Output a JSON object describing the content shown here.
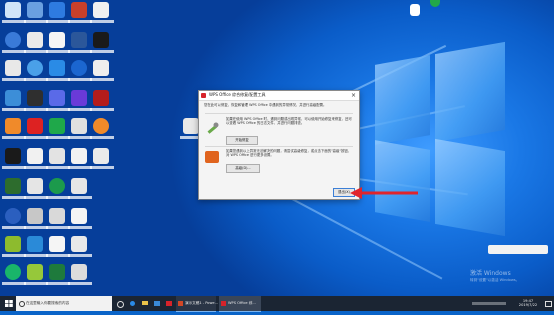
{
  "dialog": {
    "title": "WPS Office 综合修复/配置工具",
    "intro": "您在此可以修复、恢复和管理 WPS Office 中遇到的异常情况，并进行高级配置。",
    "section1_text": "如果在使用 WPS Office 时，遇到问题或出现异常，可以使用开始修复来修复，还可以查看 WPS Office 的日志文件，并进行问题排查。",
    "repair_button": "开始修复",
    "section2_text": "如果您遇到以上异常无法解决的问题，请尝试高级修复，或点击下面的\"高级\"按钮，对 WPS Office 进行更多设置。",
    "advanced_button": "高级(D)...",
    "exit_button": "退出(X)",
    "close_glyph": "×"
  },
  "taskbar": {
    "search_placeholder": "在这里输入你要搜索的内容",
    "task1_label": "演示文稿1 - Powe...",
    "task2_label": "WPS Office 综...",
    "time": "19:47",
    "date": "2019/7/22"
  },
  "watermark": {
    "line1": "激活 Windows",
    "line2": "转到\"设置\"以激活 Windows。"
  },
  "colors": {
    "desktop_blue": "#0a64c8",
    "arrow_red": "#e0242c",
    "taskbar": "#1b2533",
    "wps_red": "#d6232a"
  },
  "icons": [
    "start-windows-icon",
    "search-icon",
    "taskview-icon",
    "edge-icon",
    "explorer-icon",
    "store-icon",
    "ppt-icon",
    "wps-icon",
    "notification-icon"
  ]
}
